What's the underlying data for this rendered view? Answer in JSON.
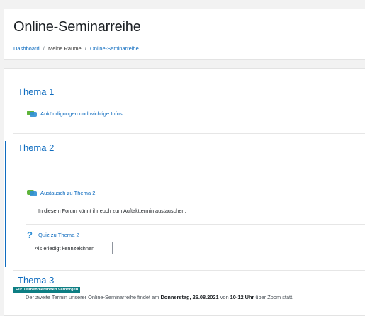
{
  "page": {
    "title": "Online-Seminarreihe"
  },
  "breadcrumb": {
    "items": [
      "Dashboard",
      "Meine Räume",
      "Online-Seminarreihe"
    ],
    "separator": "/"
  },
  "sections": [
    {
      "title": "Thema 1",
      "activities": [
        {
          "type": "forum",
          "icon": "forum-icon",
          "label": "Ankündigungen und wichtige Infos"
        }
      ]
    },
    {
      "title": "Thema 2",
      "activities": [
        {
          "type": "forum",
          "icon": "forum-icon",
          "label": "Austausch zu Thema 2",
          "description": "In diesem Forum könnt ihr euch zum Auftakttermin austauschen."
        },
        {
          "type": "quiz",
          "icon": "quiz-icon",
          "label": "Quiz zu Thema 2",
          "button_label": "Als erledigt kennzeichnen"
        }
      ]
    },
    {
      "title": "Thema 3",
      "badge": "Für Teilnehmer/innen verborgen",
      "summary": {
        "prefix": "Der zweite Termin unserer Online-Seminarreihe findet am ",
        "date": "Donnerstag, 26.08.2021",
        "middle": " von ",
        "time": "10-12 Uhr",
        "suffix": " über Zoom statt."
      }
    }
  ],
  "colors": {
    "link": "#0f6cbf",
    "badge": "#0d7e83",
    "highlight": "#0f6cbf"
  }
}
